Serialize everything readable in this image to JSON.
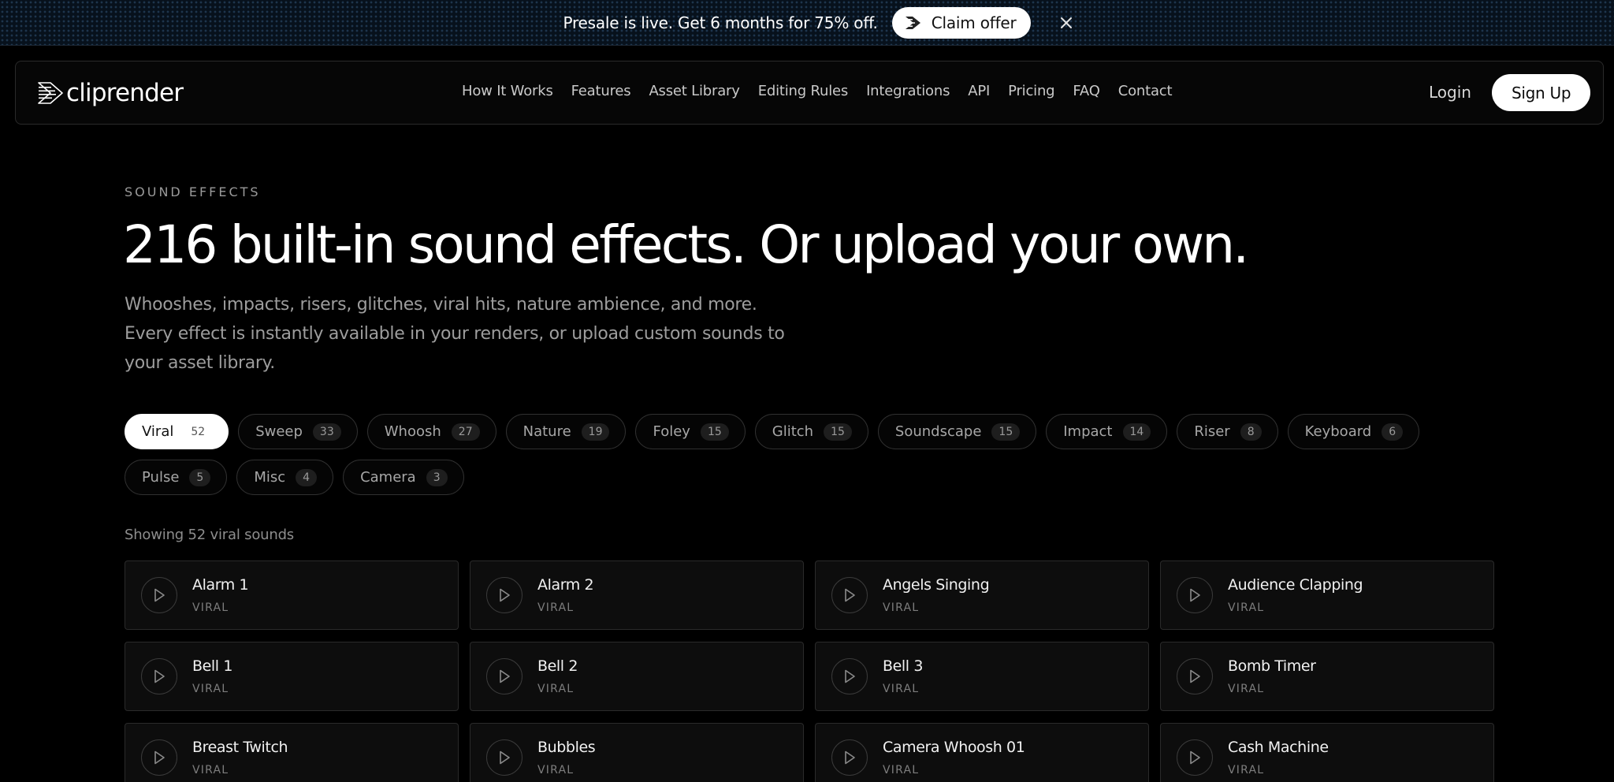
{
  "promo": {
    "text": "Presale is live. Get 6 months for 75% off.",
    "button_label": "Claim offer",
    "logo_icon": "cliprender-logo-icon",
    "close_icon": "close-icon"
  },
  "header": {
    "brand": "cliprender",
    "nav": [
      "How It Works",
      "Features",
      "Asset Library",
      "Editing Rules",
      "Integrations",
      "API",
      "Pricing",
      "FAQ",
      "Contact"
    ],
    "login": "Login",
    "signup": "Sign Up"
  },
  "hero": {
    "eyebrow": "SOUND EFFECTS",
    "headline": "216 built-in sound effects. Or upload your own.",
    "subhead": "Whooshes, impacts, risers, glitches, viral hits, nature ambience, and more. Every effect is instantly available in your renders, or upload custom sounds to your asset library."
  },
  "filters": [
    {
      "label": "Viral",
      "count": "52",
      "active": true
    },
    {
      "label": "Sweep",
      "count": "33"
    },
    {
      "label": "Whoosh",
      "count": "27"
    },
    {
      "label": "Nature",
      "count": "19"
    },
    {
      "label": "Foley",
      "count": "15"
    },
    {
      "label": "Glitch",
      "count": "15"
    },
    {
      "label": "Soundscape",
      "count": "15"
    },
    {
      "label": "Impact",
      "count": "14"
    },
    {
      "label": "Riser",
      "count": "8"
    },
    {
      "label": "Keyboard",
      "count": "6"
    },
    {
      "label": "Pulse",
      "count": "5"
    },
    {
      "label": "Misc",
      "count": "4"
    },
    {
      "label": "Camera",
      "count": "3"
    }
  ],
  "showing": "Showing 52 viral sounds",
  "sounds": [
    {
      "title": "Alarm 1",
      "tag": "VIRAL"
    },
    {
      "title": "Alarm 2",
      "tag": "VIRAL"
    },
    {
      "title": "Angels Singing",
      "tag": "VIRAL"
    },
    {
      "title": "Audience Clapping",
      "tag": "VIRAL"
    },
    {
      "title": "Bell 1",
      "tag": "VIRAL"
    },
    {
      "title": "Bell 2",
      "tag": "VIRAL"
    },
    {
      "title": "Bell 3",
      "tag": "VIRAL"
    },
    {
      "title": "Bomb Timer",
      "tag": "VIRAL"
    },
    {
      "title": "Breast Twitch",
      "tag": "VIRAL"
    },
    {
      "title": "Bubbles",
      "tag": "VIRAL"
    },
    {
      "title": "Camera Whoosh 01",
      "tag": "VIRAL"
    },
    {
      "title": "Cash Machine",
      "tag": "VIRAL"
    }
  ],
  "icons": {
    "play": "play-icon"
  }
}
